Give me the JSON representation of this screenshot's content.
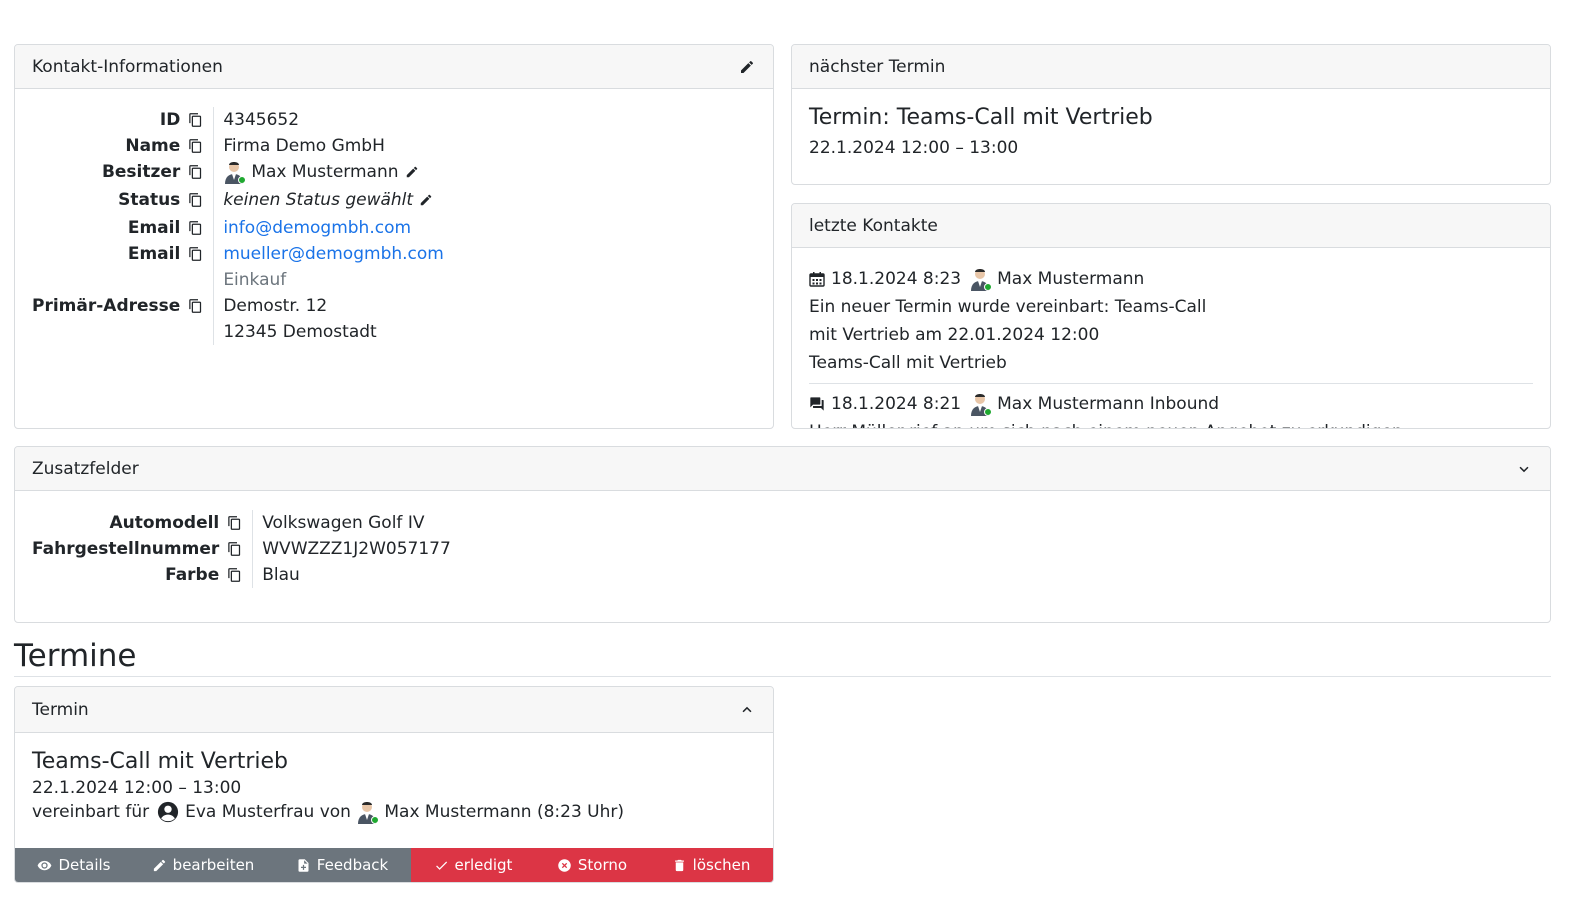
{
  "contact": {
    "header": "Kontakt-Informationen",
    "rows": [
      {
        "label": "ID",
        "value": "4345652"
      },
      {
        "label": "Name",
        "value": "Firma Demo GmbH"
      },
      {
        "label": "Besitzer",
        "value": "Max Mustermann"
      },
      {
        "label": "Status",
        "value": "keinen Status gewählt"
      },
      {
        "label": "Email",
        "value": "info@demogmbh.com"
      },
      {
        "label": "Email",
        "value": "mueller@demogmbh.com"
      },
      {
        "label": "",
        "value": "Einkauf"
      },
      {
        "label": "Primär-Adresse",
        "value": "Demostr. 12"
      },
      {
        "label": "",
        "value": "12345 Demostadt"
      }
    ]
  },
  "next_appointment": {
    "header": "nächster Termin",
    "title": "Termin: Teams-Call mit Vertrieb",
    "time": "22.1.2024 12:00 – 13:00"
  },
  "last_contacts": {
    "header": "letzte Kontakte",
    "entries": [
      {
        "icon": "calendar-icon",
        "date": "18.1.2024 8:23",
        "user": "Max Mustermann",
        "text": "Ein neuer Termin wurde vereinbart: Teams-Call",
        "text2": "mit Vertrieb am 22.01.2024 12:00",
        "detail": "Teams-Call mit Vertrieb"
      },
      {
        "icon": "chat-icon",
        "date": "18.1.2024 8:21",
        "user": "Max Mustermann",
        "text": "Inbound",
        "detail": "Herr Müller rief an um sich nach einem neuen Angebot zu erkundigen."
      }
    ]
  },
  "extra_fields": {
    "header": "Zusatzfelder",
    "rows": [
      {
        "label": "Automodell",
        "value": "Volkswagen Golf IV"
      },
      {
        "label": "Fahrgestellnummer",
        "value": "WVWZZZ1J2W057177"
      },
      {
        "label": "Farbe",
        "value": "Blau"
      }
    ]
  },
  "appointments_section": {
    "title": "Termine",
    "card": {
      "header": "Termin",
      "title": "Teams-Call mit Vertrieb",
      "time": "22.1.2024 12:00 – 13:00",
      "arranged_for_label": "vereinbart für",
      "arranged_for": "Eva Musterfrau",
      "by_label": "von",
      "by": "Max Mustermann (8:23 Uhr)",
      "buttons": {
        "details": "Details",
        "edit": "bearbeiten",
        "feedback": "Feedback",
        "done": "erledigt",
        "cancel": "Storno",
        "delete": "löschen"
      }
    }
  },
  "colors": {
    "link": "#1a73e8",
    "gray_button": "#6c757d",
    "red_button": "#dc3545",
    "online_dot": "#1fa830"
  }
}
